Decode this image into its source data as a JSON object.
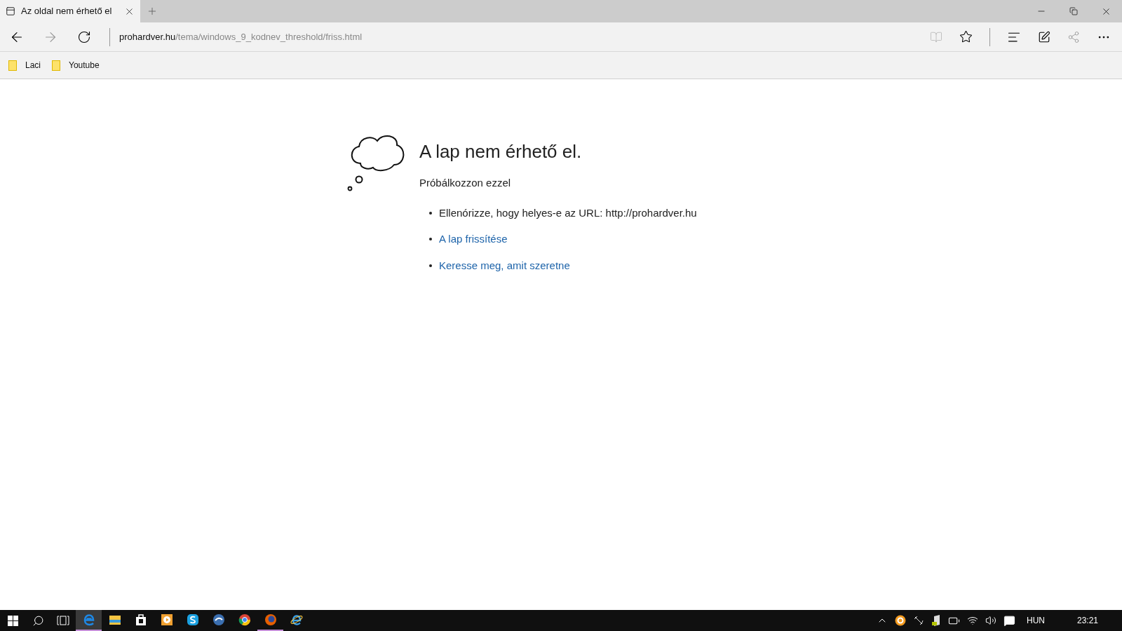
{
  "tab": {
    "title": "Az oldal nem érhető el",
    "selected": true
  },
  "address_bar": {
    "host": "prohardver.hu",
    "path": "/tema/windows_9_kodnev_threshold/friss.html"
  },
  "favorites": [
    {
      "label": "Laci"
    },
    {
      "label": "Youtube"
    }
  ],
  "error_page": {
    "heading": "A lap nem érhető el.",
    "subheading": "Próbálkozzon ezzel",
    "suggestions": [
      {
        "kind": "text",
        "text": "Ellenórizze, hogy helyes-e az URL: http://prohardver.hu"
      },
      {
        "kind": "link",
        "text": "A lap frissítése"
      },
      {
        "kind": "link",
        "text": "Keresse meg, amit szeretne"
      }
    ]
  },
  "taskbar": {
    "apps": [
      {
        "kind": "edge",
        "selected": true,
        "running": true
      },
      {
        "kind": "folder",
        "selected": false,
        "running": false
      },
      {
        "kind": "store",
        "selected": false,
        "running": false
      },
      {
        "kind": "media",
        "selected": false,
        "running": false
      },
      {
        "kind": "skype",
        "selected": false,
        "running": false
      },
      {
        "kind": "mail",
        "selected": false,
        "running": false
      },
      {
        "kind": "chrome",
        "selected": false,
        "running": false
      },
      {
        "kind": "firefox",
        "selected": false,
        "running": true
      },
      {
        "kind": "ie",
        "selected": false,
        "running": false
      }
    ],
    "language": "HUN",
    "time": "23:21"
  }
}
